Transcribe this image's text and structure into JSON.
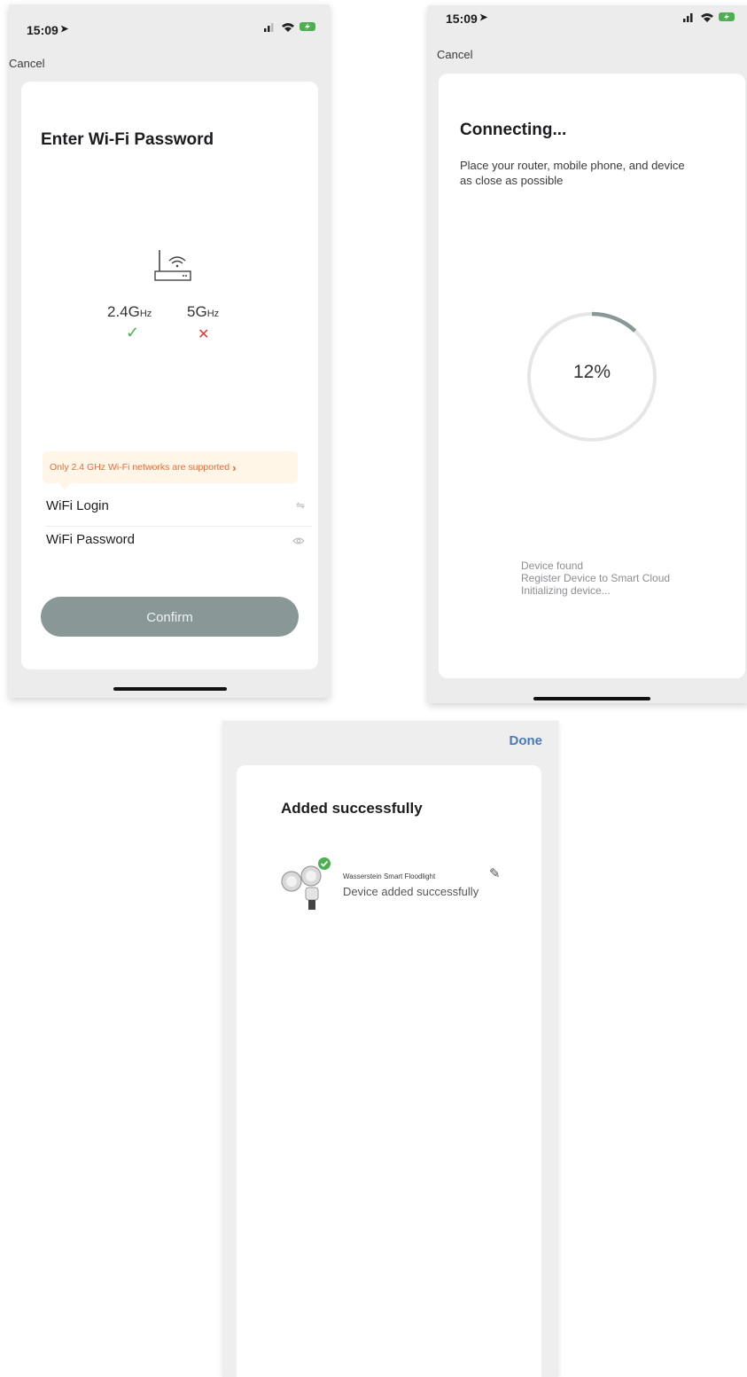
{
  "screen1": {
    "time": "15:09",
    "cancel": "Cancel",
    "title": "Enter Wi-Fi Password",
    "band_24_main": "2.4G",
    "band_24_unit": "Hz",
    "band_5_main": "5G",
    "band_5_unit": "Hz",
    "check": "✓",
    "cross": "✕",
    "notice": "Only 2.4 GHz Wi-Fi networks are supported",
    "notice_chevron": "›",
    "wifi_login_label": "WiFi Login",
    "wifi_password_label": "WiFi Password",
    "confirm": "Confirm",
    "icons": {
      "location": "location-arrow-icon",
      "signal": "cellular-signal-icon",
      "wifi": "wifi-icon",
      "battery": "battery-charging-icon",
      "switch": "swap-arrows-icon",
      "eye": "eye-icon"
    },
    "colors": {
      "notice_text": "#ec6a3a",
      "notice_bg": "#fff6e8",
      "check": "#4caf50",
      "cross": "#e53935",
      "button": "#8a9797"
    }
  },
  "screen2": {
    "time": "15:09",
    "cancel": "Cancel",
    "title": "Connecting...",
    "subtitle": "Place your router, mobile phone, and device as close as possible",
    "progress_text": "12%",
    "progress_value": 0.12,
    "steps": [
      "Device found",
      "Register Device to Smart Cloud",
      "Initializing device..."
    ]
  },
  "screen3": {
    "done": "Done",
    "title": "Added successfully",
    "device_name": "Wasserstein Smart Floodlight",
    "device_status": "Device added successfully",
    "colors": {
      "done": "#4a79b8",
      "success_badge": "#4caf50"
    }
  }
}
